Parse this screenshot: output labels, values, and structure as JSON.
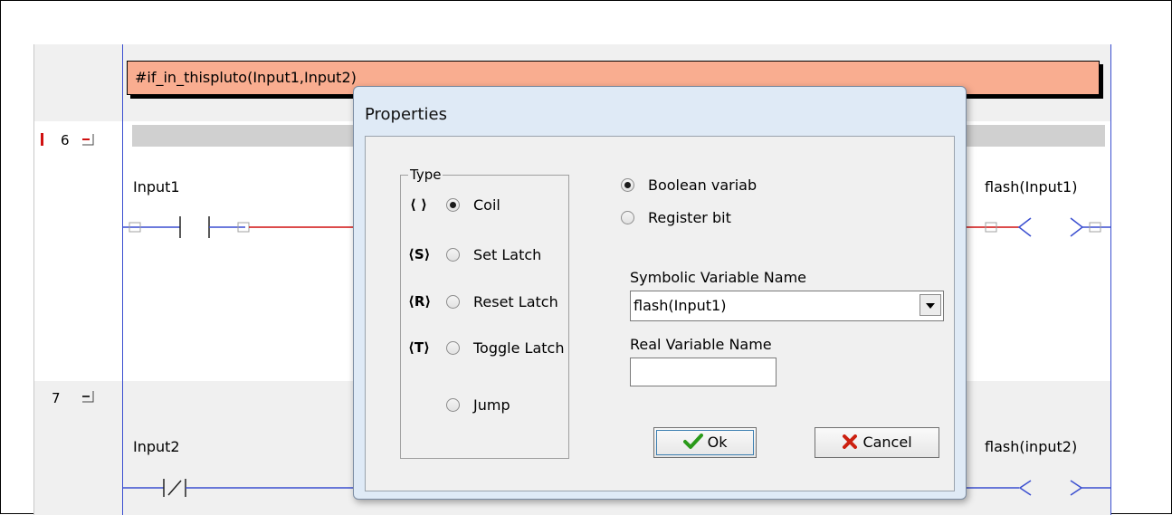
{
  "ladder": {
    "if_block": "#if_in_thispluto(Input1,Input2)",
    "rungs": [
      {
        "number": "6",
        "contact_label": "Input1",
        "coil_label": "flash(Input1)"
      },
      {
        "number": "7",
        "contact_label": "Input2",
        "coil_label": "flash(input2)"
      }
    ],
    "colors": {
      "if_block": "#f9ad90",
      "rail": "#3b4fd0",
      "wire_red": "#d01010",
      "marker": "#d01010"
    }
  },
  "dialog": {
    "title": "Properties",
    "type_group": {
      "legend": "Type",
      "options": [
        {
          "symbol": "⟨ ⟩",
          "label": "Coil",
          "checked": true
        },
        {
          "symbol": "⟨S⟩",
          "label": "Set Latch",
          "checked": false
        },
        {
          "symbol": "⟨R⟩",
          "label": "Reset Latch",
          "checked": false
        },
        {
          "symbol": "⟨T⟩",
          "label": "Toggle Latch",
          "checked": false
        },
        {
          "symbol": "",
          "label": "Jump",
          "checked": false
        }
      ]
    },
    "variable_kind": {
      "options": [
        {
          "label": "Boolean variab",
          "checked": true
        },
        {
          "label": "Register bit",
          "checked": false
        }
      ]
    },
    "symbolic_name": {
      "label": "Symbolic Variable Name",
      "value": "flash(Input1)"
    },
    "real_name": {
      "label": "Real Variable Name",
      "value": ""
    },
    "ok_label": "Ok",
    "cancel_label": "Cancel",
    "icons": {
      "ok": "checkmark-icon",
      "cancel": "x-icon"
    },
    "colors": {
      "ok_check": "#2a9a1a",
      "cancel_x": "#cc2010"
    }
  }
}
